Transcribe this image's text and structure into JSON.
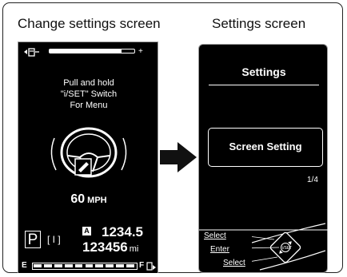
{
  "captions": {
    "left": "Change settings screen",
    "right": "Settings screen"
  },
  "left_screen": {
    "fuel": {
      "left_icon": "fuel-pump-icon",
      "plus": "+",
      "level": 0.85
    },
    "message": [
      "Pull and hold",
      "\"i/SET\" Switch",
      "For Menu"
    ],
    "speed": {
      "value": "60",
      "unit": "MPH"
    },
    "gear": "P",
    "gear_position": "[ I ]",
    "trip_label": "A",
    "trip_value": "1234.5",
    "odometer": {
      "value": "123456",
      "unit": "mi"
    },
    "temp_gauge": {
      "left_letter": "E",
      "right_letter": "F",
      "segments": 10,
      "filled": 10
    }
  },
  "right_screen": {
    "title": "Settings",
    "selected_item": "Screen Setting",
    "page_indicator": "1/4",
    "controls": [
      "Select",
      "Enter",
      "Select"
    ],
    "switch_label": "i/SET"
  },
  "colors": {
    "screen_bg": "#000000",
    "screen_fg": "#ffffff",
    "arrow": "#111111"
  }
}
